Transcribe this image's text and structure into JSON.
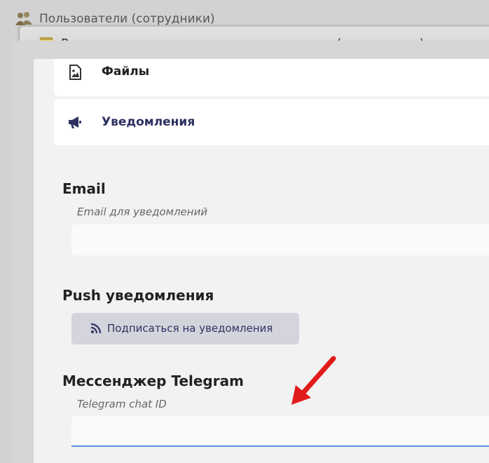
{
  "background_window": {
    "title": "Пользователи (сотрудники)",
    "icon": "users-icon"
  },
  "dialog": {
    "title": "Редактирование карточки пользователя (сотрудника)",
    "icon": "notepad-icon"
  },
  "nav": {
    "files": {
      "label": "Файлы",
      "icon": "image-file-icon"
    },
    "notifications": {
      "label": "Уведомления",
      "icon": "megaphone-icon"
    }
  },
  "email": {
    "heading": "Email",
    "label": "Email для уведомлений",
    "value": ""
  },
  "push": {
    "heading": "Push уведомления",
    "button_label": "Подписаться на уведомления",
    "button_icon": "rss-icon"
  },
  "telegram": {
    "heading": "Мессенджер Telegram",
    "label": "Telegram chat ID",
    "value": ""
  },
  "annotation": {
    "icon": "red-arrow-icon",
    "color": "#e01b1b"
  }
}
